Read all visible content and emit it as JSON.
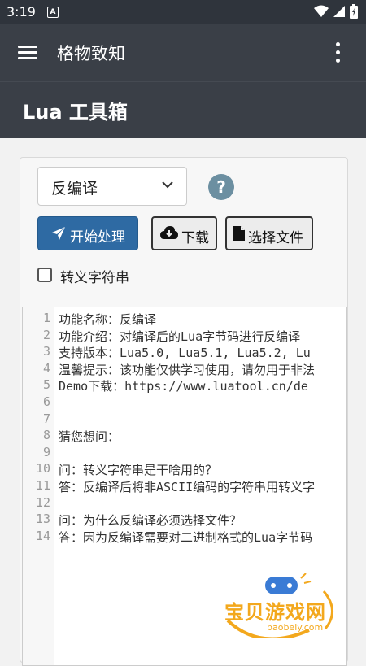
{
  "status_bar": {
    "time": "3:19",
    "notification": "A"
  },
  "app_bar": {
    "title": "格物致知"
  },
  "page_header": {
    "title": "Lua 工具箱"
  },
  "toolbar": {
    "mode_select": {
      "value": "反编译"
    },
    "help_label": "?",
    "start_button": "开始处理",
    "download_button": "下载",
    "select_file_button": "选择文件",
    "escape_checkbox": {
      "label": "转义字符串",
      "checked": false
    }
  },
  "editor": {
    "lines": [
      {
        "num": "1",
        "text": "功能名称：反编译"
      },
      {
        "num": "2",
        "text": "功能介绍：对编译后的Lua字节码进行反编译"
      },
      {
        "num": "3",
        "text": "支持版本：Lua5.0, Lua5.1, Lua5.2, Lu"
      },
      {
        "num": "4",
        "text": "温馨提示：该功能仅供学习使用，请勿用于非法"
      },
      {
        "num": "5",
        "text": "Demo下载：https://www.luatool.cn/de"
      },
      {
        "num": "6",
        "text": ""
      },
      {
        "num": "7",
        "text": ""
      },
      {
        "num": "8",
        "text": "猜您想问："
      },
      {
        "num": "9",
        "text": ""
      },
      {
        "num": "10",
        "text": "问：转义字符串是干啥用的？"
      },
      {
        "num": "11",
        "text": "答：反编译后将非ASCII编码的字符串用转义字"
      },
      {
        "num": "12",
        "text": ""
      },
      {
        "num": "13",
        "text": "问：为什么反编译必须选择文件？"
      },
      {
        "num": "14",
        "text": "答：因为反编译需要对二进制格式的Lua字节码"
      }
    ]
  },
  "watermark": {
    "text": "宝贝游戏网",
    "url": "baobeiy.com"
  },
  "colors": {
    "primary": "#2e6aa3",
    "appbar": "#3a3f47",
    "statusbar": "#2f343c",
    "help": "#6c8fa1"
  }
}
